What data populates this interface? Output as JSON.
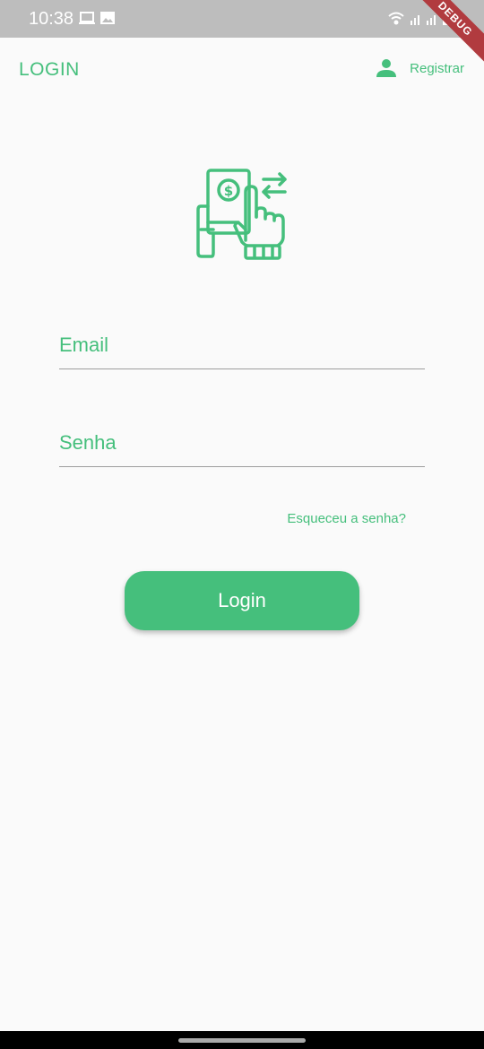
{
  "status_bar": {
    "time": "10:38",
    "debug_label": "DEBUG",
    "icons": [
      "laptop-icon",
      "image-icon",
      "wifi-icon",
      "signal-icon",
      "signal-icon",
      "battery-icon"
    ]
  },
  "app_bar": {
    "title": "LOGIN",
    "register_label": "Registrar"
  },
  "form": {
    "email_placeholder": "Email",
    "password_placeholder": "Senha",
    "forgot_label": "Esqueceu a senha?",
    "login_label": "Login"
  },
  "colors": {
    "accent": "#45bf7c",
    "background": "#fafafa",
    "status_bar": "#bdbdbd",
    "debug_banner": "#b13b3f"
  }
}
